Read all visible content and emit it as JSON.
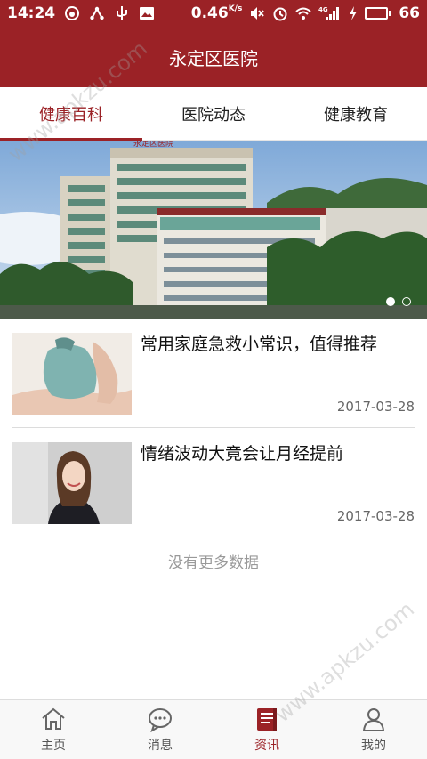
{
  "status_bar": {
    "time": "14:24",
    "net_speed": "0.46",
    "net_speed_unit": "K/s",
    "network_label": "4G",
    "battery_level": "66",
    "battery_fraction": 0.66,
    "icons": [
      "weibo-icon",
      "usb-share-icon",
      "usb-icon",
      "image-icon",
      "mute-icon",
      "alarm-icon",
      "wifi-icon",
      "signal-icon",
      "charging-icon",
      "battery-icon"
    ]
  },
  "header": {
    "title": "永定区医院"
  },
  "tabs": [
    {
      "label": "健康百科",
      "active": true
    },
    {
      "label": "医院动态",
      "active": false
    },
    {
      "label": "健康教育",
      "active": false
    }
  ],
  "banner": {
    "sign_text": "永定区医院",
    "slides": 2,
    "active_slide": 1
  },
  "news": [
    {
      "title": "常用家庭急救小常识，值得推荐",
      "date": "2017-03-28"
    },
    {
      "title": "情绪波动大竟会让月经提前",
      "date": "2017-03-28"
    }
  ],
  "list_footer": "没有更多数据",
  "bottom_nav": [
    {
      "label": "主页",
      "icon": "home-icon",
      "active": false
    },
    {
      "label": "消息",
      "icon": "message-icon",
      "active": false
    },
    {
      "label": "资讯",
      "icon": "news-icon",
      "active": true
    },
    {
      "label": "我的",
      "icon": "profile-icon",
      "active": false
    }
  ],
  "watermark": "www.apkzu.com",
  "colors": {
    "brand": "#9b2226",
    "date": "#666666",
    "muted": "#999999"
  }
}
